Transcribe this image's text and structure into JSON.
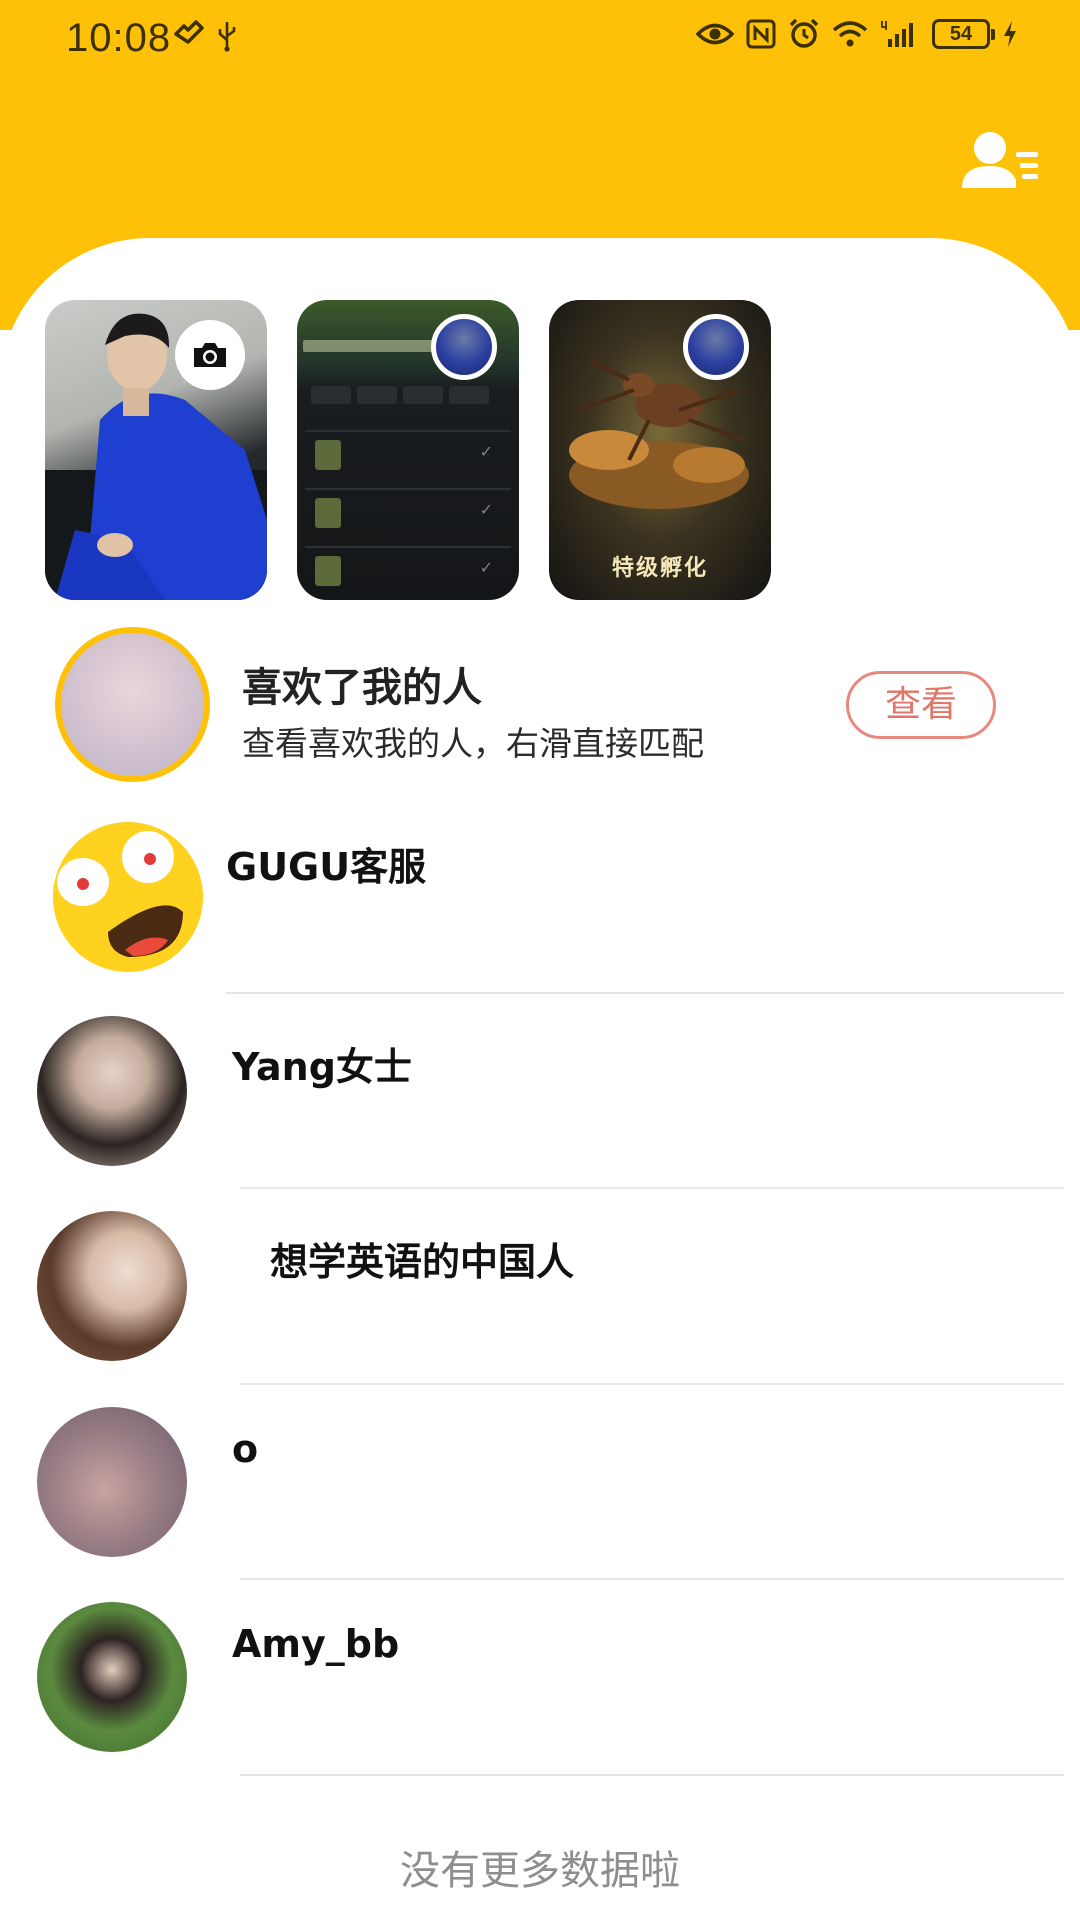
{
  "status_bar": {
    "time": "10:08",
    "battery": "54",
    "icons": [
      "vpn-icon",
      "usb-icon",
      "eye-icon",
      "nfc-icon",
      "alarm-icon",
      "wifi-icon",
      "signal-4g-icon",
      "battery-icon",
      "charging-icon"
    ]
  },
  "header": {
    "contacts_icon": "user-list-icon",
    "accent_color": "#FFC107"
  },
  "stories": [
    {
      "type": "own-photo",
      "badge_icon": "camera-icon"
    },
    {
      "type": "game-screenshot",
      "badge_icon": "avatar"
    },
    {
      "type": "game-art",
      "badge_icon": "avatar",
      "caption": "特级孵化"
    }
  ],
  "likes": {
    "title": "喜欢了我的人",
    "subtitle": "查看喜欢我的人，右滑直接匹配",
    "button_label": "查看",
    "button_color": "#E0766A"
  },
  "conversations": [
    {
      "name": "GUGU客服"
    },
    {
      "name": "Yang女士"
    },
    {
      "name": "想学英语的中国人"
    },
    {
      "name": "o"
    },
    {
      "name": "Amy_bb"
    }
  ],
  "footer": {
    "text": "没有更多数据啦"
  }
}
